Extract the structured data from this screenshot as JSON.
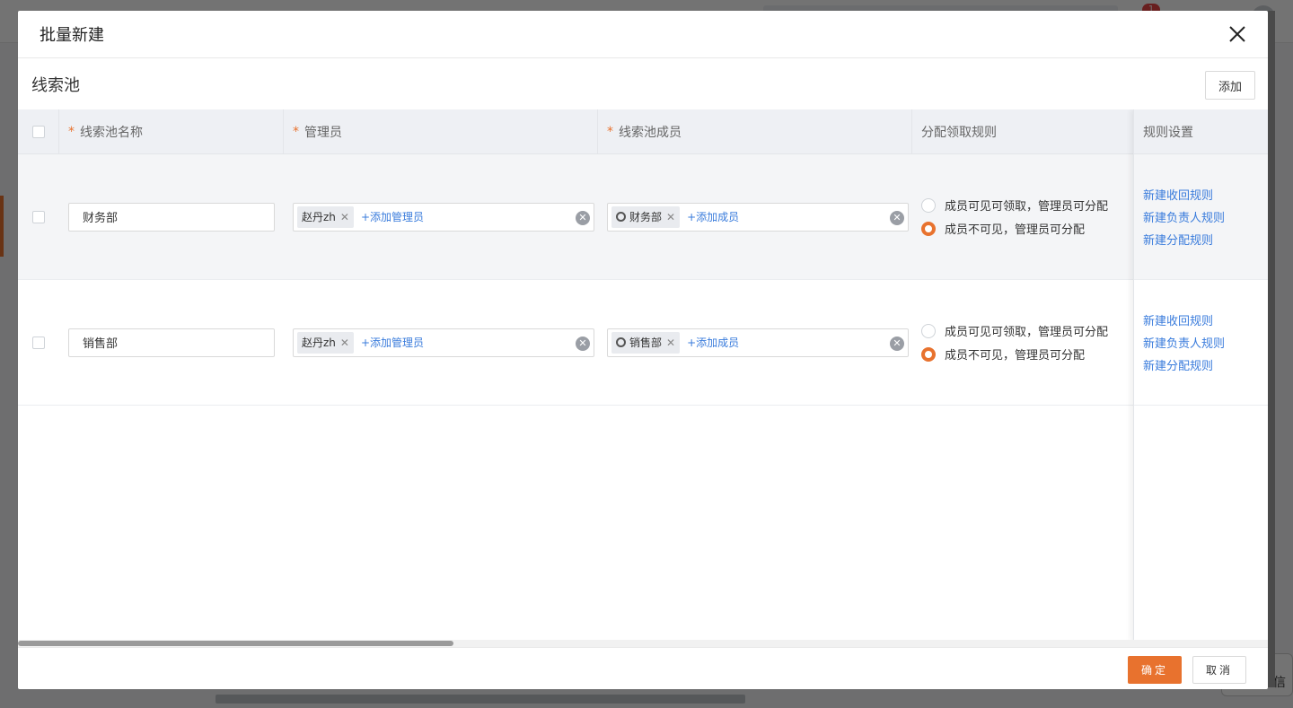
{
  "background": {
    "badge_count": "1",
    "side_text": "信"
  },
  "modal": {
    "title": "批量新建",
    "section_title": "线索池",
    "add_button": "添加",
    "columns": {
      "name": "线索池名称",
      "admins": "管理员",
      "members": "线索池成员",
      "rule": "分配领取规则",
      "rule_settings": "规则设置"
    },
    "required_mark": "*",
    "rows": [
      {
        "name": "财务部",
        "admin_tag": "赵丹zh",
        "add_admin": "+添加管理员",
        "member_tag": "财务部",
        "add_member": "+添加成员",
        "radio_options": [
          "成员可见可领取，管理员可分配",
          "成员不可见，管理员可分配"
        ],
        "selected_option": 1,
        "rule_links": [
          "新建收回规则",
          "新建负责人规则",
          "新建分配规则"
        ]
      },
      {
        "name": "销售部",
        "admin_tag": "赵丹zh",
        "add_admin": "+添加管理员",
        "member_tag": "销售部",
        "add_member": "+添加成员",
        "radio_options": [
          "成员可见可领取，管理员可分配",
          "成员不可见，管理员可分配"
        ],
        "selected_option": 1,
        "rule_links": [
          "新建收回规则",
          "新建负责人规则",
          "新建分配规则"
        ]
      }
    ],
    "footer": {
      "ok": "确定",
      "cancel": "取消"
    }
  },
  "colors": {
    "accent": "#e8722e",
    "link": "#3a7cdc"
  }
}
